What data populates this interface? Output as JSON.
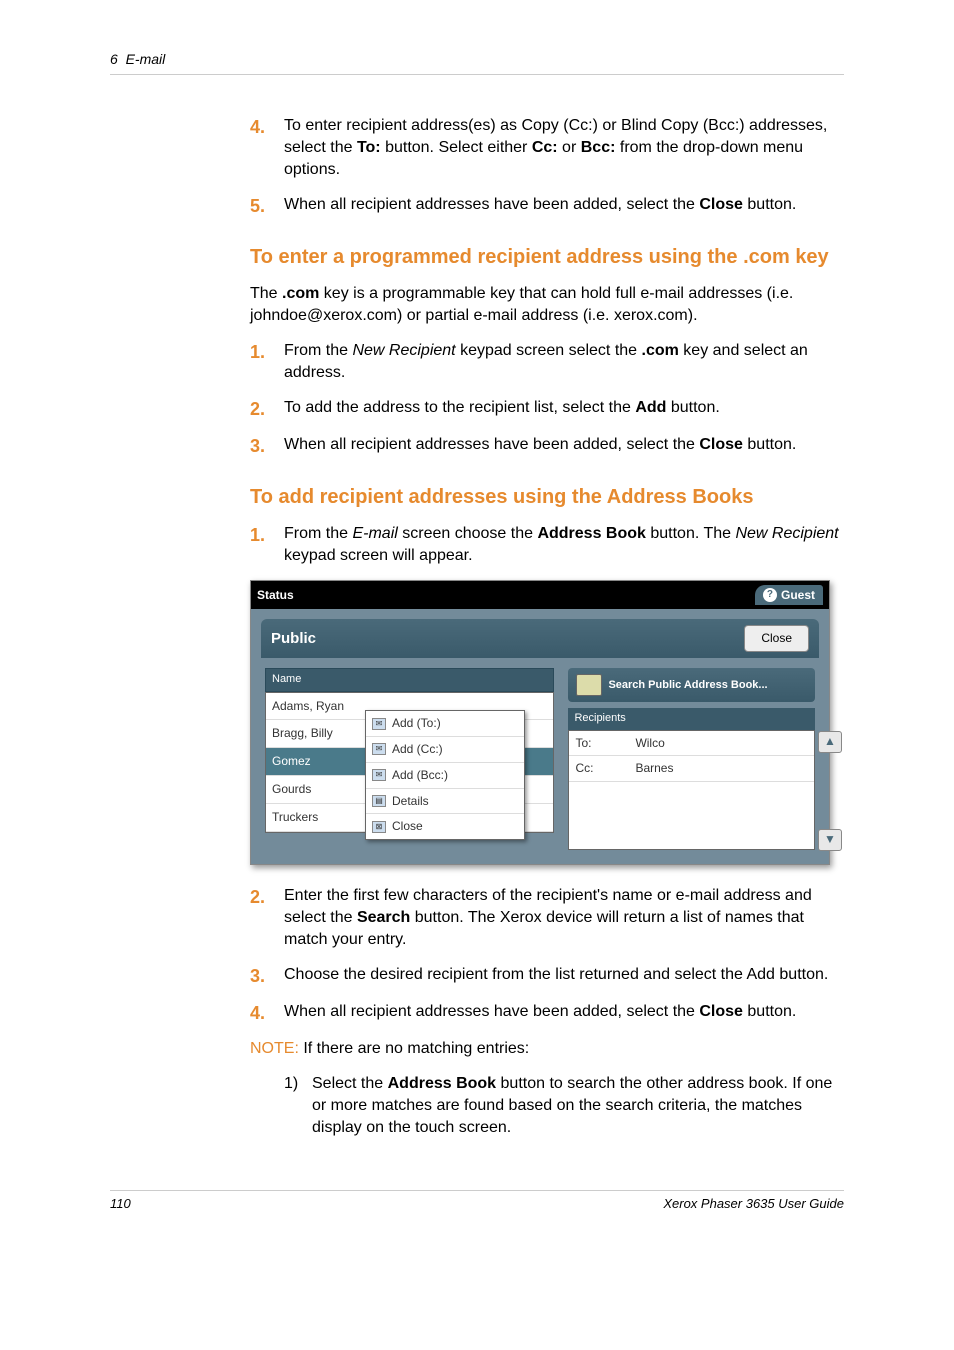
{
  "header": {
    "chapter": "6",
    "section": "E-mail"
  },
  "intro_steps": [
    {
      "num": "4.",
      "html": "To enter recipient address(es) as Copy (Cc:) or Blind Copy (Bcc:) addresses, select the <b>To:</b> button. Select either <b>Cc:</b> or <b>Bcc:</b> from the drop-down menu options."
    },
    {
      "num": "5.",
      "html": "When all recipient addresses have been added, select the <b>Close</b> button."
    }
  ],
  "section1": {
    "title": "To enter a programmed recipient address using the .com key",
    "intro": "The <b>.com</b> key is a programmable key that can hold full e-mail addresses (i.e. johndoe@xerox.com) or partial e-mail address (i.e. xerox.com).",
    "steps": [
      {
        "num": "1.",
        "html": "From the <span class=\"italic\">New Recipient</span> keypad screen select the <b>.com</b> key and select an address."
      },
      {
        "num": "2.",
        "html": "To add the address to the recipient list, select the <b>Add</b> button."
      },
      {
        "num": "3.",
        "html": "When all recipient addresses have been added, select the <b>Close</b> button."
      }
    ]
  },
  "section2": {
    "title": "To add recipient addresses using the Address Books",
    "step1": {
      "num": "1.",
      "html": "From the <span class=\"italic\">E-mail</span> screen choose the <b>Address Book</b> button. The <span class=\"italic\">New Recipient</span> keypad screen will appear."
    },
    "steps_after": [
      {
        "num": "2.",
        "html": "Enter the first few characters of the recipient's name or e-mail address and select the <b>Search</b> button. The Xerox device will return a list of names that match your entry."
      },
      {
        "num": "3.",
        "html": "Choose the desired recipient from the list returned and select the Add button."
      },
      {
        "num": "4.",
        "html": "When all recipient addresses have been added, select the <b>Close</b> button."
      }
    ],
    "note_label": "NOTE:",
    "note_text": " If there are no matching entries:",
    "substep": {
      "num": "1)",
      "text": "Select the <b>Address Book</b> button to search the other address book. If one or more matches are found based on the search criteria, the matches display on the touch screen."
    }
  },
  "device": {
    "status": "Status",
    "guest": "Guest",
    "title": "Public",
    "close": "Close",
    "name_header": "Name",
    "names": [
      "Adams, Ryan",
      "Bragg, Billy",
      "Gomez",
      "Gourds",
      "Truckers"
    ],
    "popup": [
      "Add (To:)",
      "Add (Cc:)",
      "Add (Bcc:)",
      "Details",
      "Close"
    ],
    "search_label": "Search Public Address Book...",
    "recipients_header": "Recipients",
    "recipients": [
      {
        "lbl": "To:",
        "val": "Wilco"
      },
      {
        "lbl": "Cc:",
        "val": "Barnes"
      }
    ]
  },
  "footer": {
    "page": "110",
    "doc": "Xerox Phaser 3635 User Guide"
  }
}
